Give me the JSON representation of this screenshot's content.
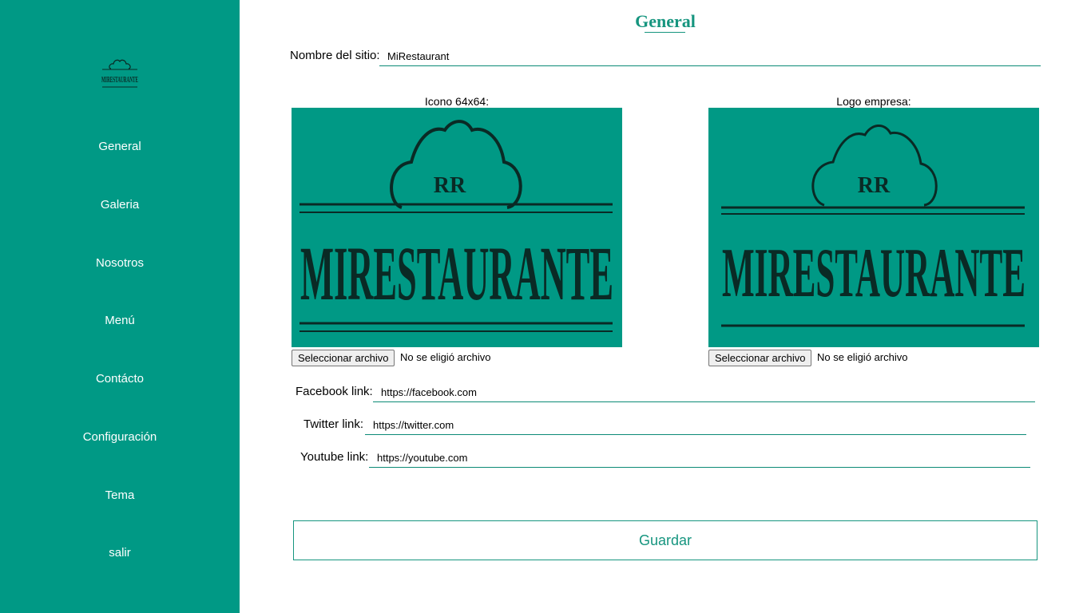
{
  "sidebar": {
    "logo_icon": "restaurant-logo",
    "items": [
      {
        "label": "General"
      },
      {
        "label": "Galeria"
      },
      {
        "label": "Nosotros"
      },
      {
        "label": "Menú"
      },
      {
        "label": "Contácto"
      },
      {
        "label": "Configuración"
      },
      {
        "label": "Tema"
      },
      {
        "label": "salir"
      }
    ]
  },
  "main": {
    "title": "General",
    "site_name": {
      "label": "Nombre del sitio:",
      "value": "MiRestaurant"
    },
    "icon_upload": {
      "caption": "Icono 64x64:",
      "image_text": "MIRESTAURANTE",
      "image_monogram": "RR",
      "button_label": "Seleccionar archivo",
      "status": "No se eligió archivo"
    },
    "logo_upload": {
      "caption": "Logo empresa:",
      "image_text": "MIRESTAURANTE",
      "image_monogram": "RR",
      "button_label": "Seleccionar archivo",
      "status": "No se eligió archivo"
    },
    "facebook": {
      "label": "Facebook link:",
      "value": "https://facebook.com"
    },
    "twitter": {
      "label": "Twitter link:",
      "value": "https://twitter.com"
    },
    "youtube": {
      "label": "Youtube link:",
      "value": "https://youtube.com"
    },
    "save_label": "Guardar"
  },
  "colors": {
    "accent": "#009985",
    "accent_text": "#16957f",
    "logo_ink": "#0a2a25"
  }
}
